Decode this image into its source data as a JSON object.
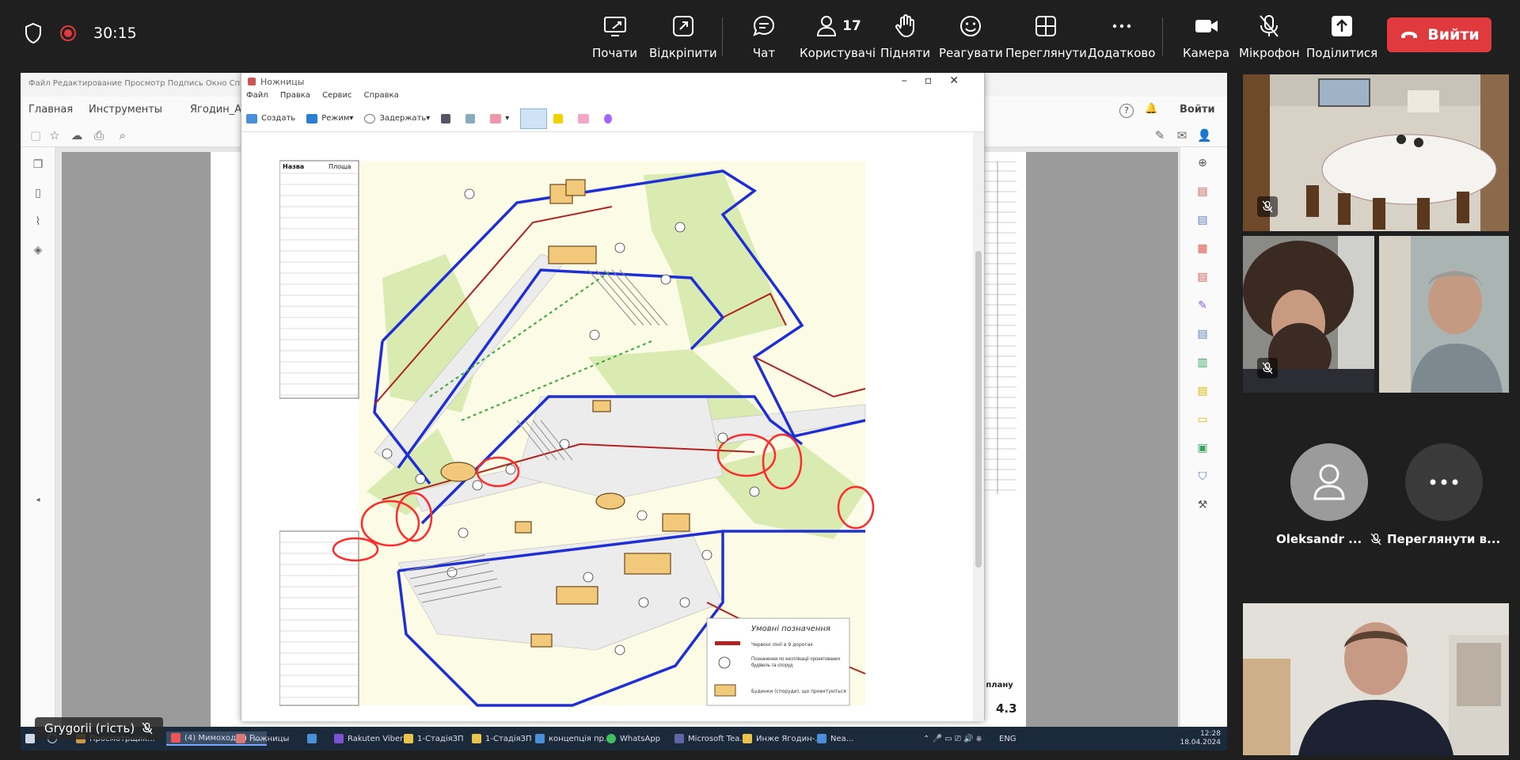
{
  "meeting": {
    "timer": "30:15",
    "toolbar": [
      {
        "id": "start",
        "label": "Почати",
        "icon": "screen-share-icon"
      },
      {
        "id": "unpin",
        "label": "Відкріпити",
        "icon": "pop-out-icon"
      },
      {
        "id": "chat",
        "label": "Чат",
        "icon": "chat-icon"
      },
      {
        "id": "users",
        "label": "Користувачі",
        "icon": "people-icon",
        "count": "17"
      },
      {
        "id": "raise",
        "label": "Підняти",
        "icon": "raise-hand-icon"
      },
      {
        "id": "react",
        "label": "Реагувати",
        "icon": "smile-icon"
      },
      {
        "id": "view",
        "label": "Переглянути",
        "icon": "grid-view-icon"
      },
      {
        "id": "more",
        "label": "Додатково",
        "icon": "more-dots-icon"
      },
      {
        "id": "camera",
        "label": "Камера",
        "icon": "camera-icon"
      },
      {
        "id": "mic",
        "label": "Мікрофон",
        "icon": "mic-off-icon"
      },
      {
        "id": "share",
        "label": "Поділитися",
        "icon": "share-upload-icon"
      }
    ],
    "leave_label": "Вийти",
    "colors": {
      "bg": "#1f1f1f",
      "leave": "#e03a3e",
      "selected_outline": "#8b8cf5"
    }
  },
  "shared_screen": {
    "acrobat": {
      "menu": "Файл  Редактирование  Просмотр  Подпись  Окно  Справка",
      "tabs": [
        "Главная",
        "Инструменты",
        "Ягодин_Авто"
      ],
      "signin": "Войти",
      "page_label_right": "ного плану",
      "page_number": "4.3"
    },
    "snipping_tool": {
      "title": "Ножницы",
      "menu": [
        "Файл",
        "Правка",
        "Сервис",
        "Справка"
      ],
      "tools": [
        "Создать",
        "Режим",
        "Задержать"
      ],
      "legend": {
        "title": "Умовні позначення",
        "items": [
          "Червоні лінії в 9 дорогах",
          "Позначення по експлікації проектованих будівель та споруд",
          "Будинки (споруди), що проектуються"
        ]
      },
      "table_header": [
        "Назва",
        "Площа"
      ]
    },
    "presenter_name": "Grygorii (гість)",
    "taskbar": {
      "items": [
        "Просмотрщик...",
        "(4) Мимоходом Г...",
        "Ножницы",
        "Rakuten Viber",
        "1-СтадіяЗП",
        "1-СтадіяЗП",
        "концепція пр...",
        "WhatsApp",
        "Microsoft Tea...",
        "Инже Ягодин-...",
        "Nea..."
      ],
      "lang": "ENG",
      "time": "12:28",
      "date": "18.04.2024"
    }
  },
  "participants": [
    {
      "id": "room",
      "muted": true
    },
    {
      "id": "bearded-man",
      "muted": true
    },
    {
      "id": "older-man",
      "muted": false,
      "selected": true
    },
    {
      "id": "oleksandr",
      "name": "Oleksandr ...",
      "muted": true,
      "avatar": "person-icon"
    },
    {
      "id": "view-more",
      "name": "Переглянути в...",
      "avatar": "more-dots-icon"
    },
    {
      "id": "young-man",
      "muted": false
    }
  ]
}
